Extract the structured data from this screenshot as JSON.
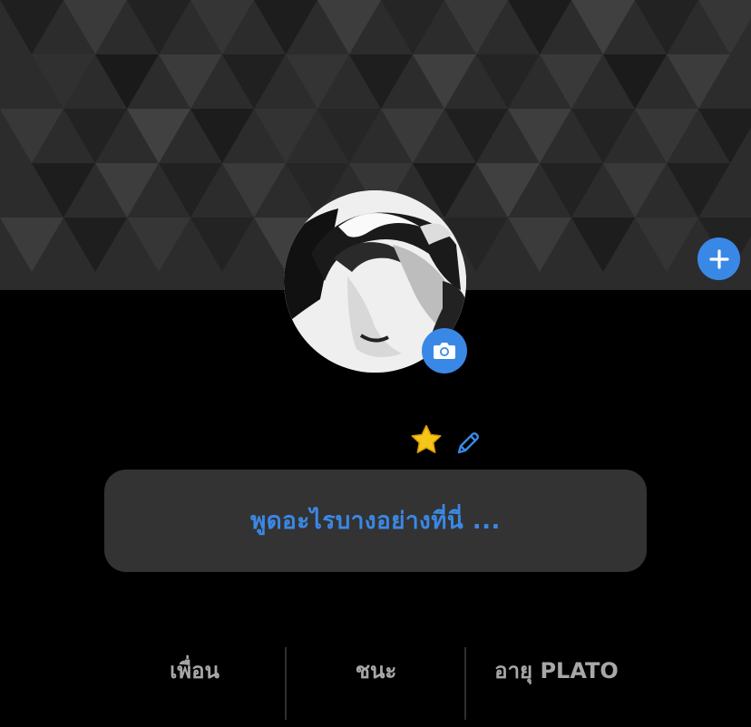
{
  "profile": {
    "status_placeholder": "พูดอะไรบางอย่างที่นี่ ..."
  },
  "stats": [
    {
      "label": "เพื่อน"
    },
    {
      "label": "ชนะ"
    },
    {
      "label": "อายุ PLATO"
    }
  ],
  "icons": {
    "add": "plus-icon",
    "camera": "camera-icon",
    "favorite": "star-icon",
    "edit": "pencil-icon"
  },
  "colors": {
    "accent": "#3a88e6",
    "background": "#000000",
    "card": "#333333",
    "muted_text": "#a7a7a7",
    "star": "#f5c518"
  }
}
